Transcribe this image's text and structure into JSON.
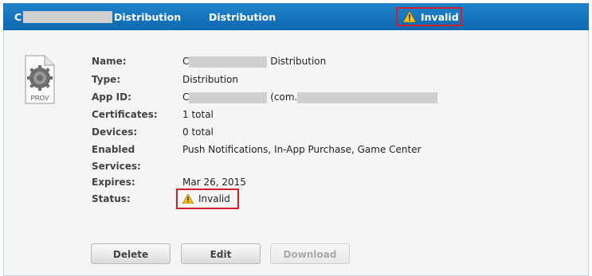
{
  "header": {
    "name_prefix": "C",
    "name_suffix": "Distribution",
    "type": "Distribution",
    "status": "Invalid"
  },
  "details": {
    "labels": {
      "name": "Name:",
      "type": "Type:",
      "app_id": "App ID:",
      "certificates": "Certificates:",
      "devices": "Devices:",
      "enabled_services_1": "Enabled",
      "enabled_services_2": "Services:",
      "expires": "Expires:",
      "status": "Status:"
    },
    "values": {
      "name_prefix": "C",
      "name_suffix": "Distribution",
      "type": "Distribution",
      "app_id_prefix": "C",
      "app_id_mid": "(com.",
      "certificates": "1 total",
      "devices": "0 total",
      "enabled_services": "Push Notifications, In-App Purchase, Game Center",
      "expires": "Mar 26, 2015",
      "status": "Invalid"
    }
  },
  "icon": {
    "label": "PROV"
  },
  "buttons": {
    "delete": "Delete",
    "edit": "Edit",
    "download": "Download"
  }
}
